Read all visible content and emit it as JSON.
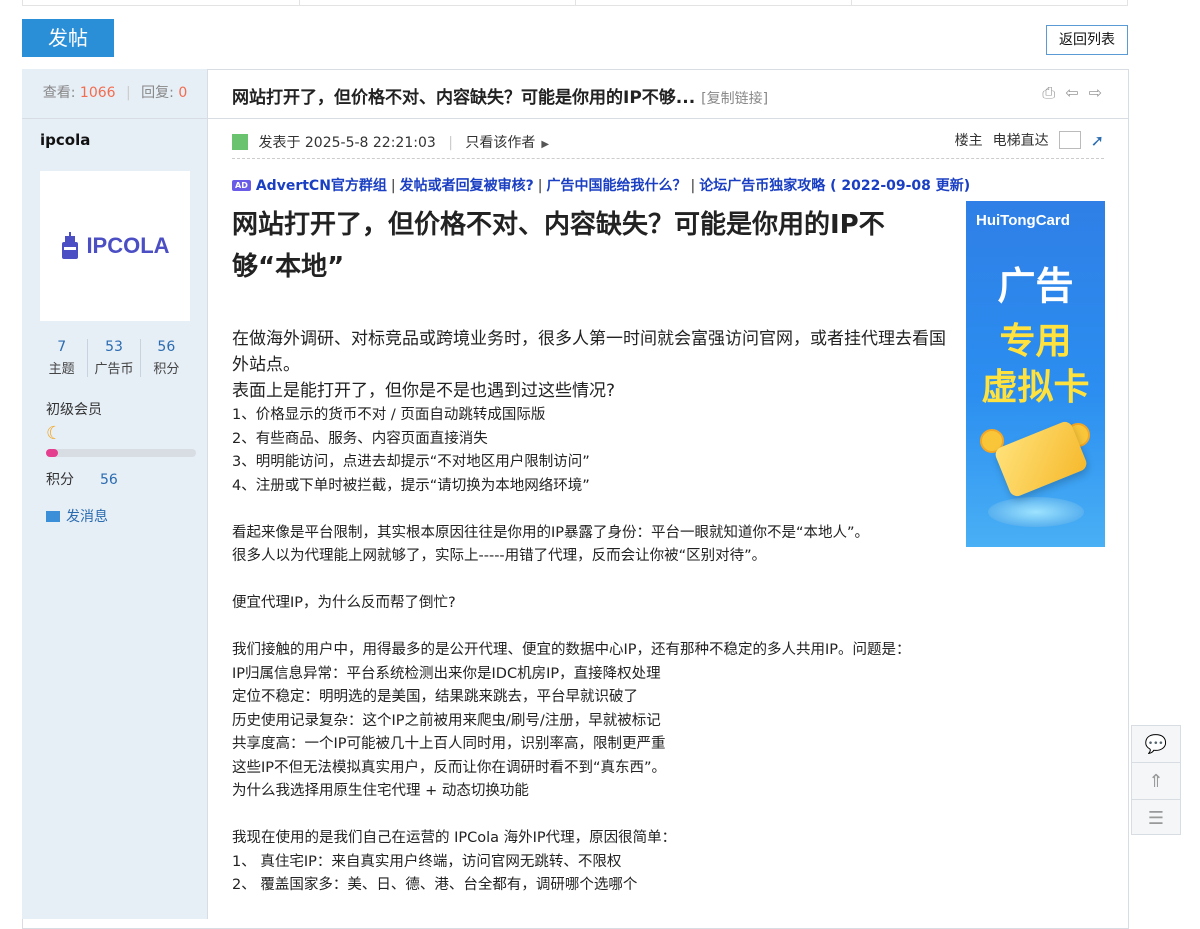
{
  "toolbar": {
    "post_label": "发帖",
    "back_label": "返回列表"
  },
  "stats": {
    "views_label": "查看:",
    "views": "1066",
    "replies_label": "回复:",
    "replies": "0"
  },
  "thread": {
    "title": "网站打开了，但价格不对、内容缺失？可能是你用的IP不够...",
    "copy_link": "[复制链接]"
  },
  "author": {
    "name": "ipcola",
    "avatar_text": "IPCOLA",
    "stats": [
      {
        "value": "7",
        "label": "主题"
      },
      {
        "value": "53",
        "label": "广告币"
      },
      {
        "value": "56",
        "label": "积分"
      }
    ],
    "level": "初级会员",
    "level_progress": 0.08,
    "points_label": "积分",
    "points": "56",
    "send_message": "发消息"
  },
  "post_meta": {
    "posted_at": "发表于 2025-5-8 22:21:03",
    "only_author": "只看该作者",
    "floor": "楼主",
    "elevator": "电梯直达"
  },
  "links": [
    "AdvertCN官方群组",
    "发帖或者回复被审核?",
    "广告中国能给我什么？",
    "论坛广告币独家攻略 ( 2022-09-08 更新)"
  ],
  "ad": {
    "brand": "HuiTongCard",
    "line1": "广告",
    "line2": "专用",
    "line3": "虚拟卡"
  },
  "post": {
    "headline": "网站打开了，但价格不对、内容缺失？可能是你用的IP不够“本地”",
    "intro1": "在做海外调研、对标竞品或跨境业务时，很多人第一时间就会富强访问官网，或者挂代理去看国外站点。",
    "intro2": "表面上是能打开了，但你是不是也遇到过这些情况?",
    "items1": [
      "1、价格显示的货币不对 / 页面自动跳转成国际版",
      "2、有些商品、服务、内容页面直接消失",
      "3、明明能访问，点进去却提示“不对地区用户限制访问”",
      "4、注册或下单时被拦截，提示“请切换为本地网络环境”"
    ],
    "para2": [
      "看起来像是平台限制，其实根本原因往往是你用的IP暴露了身份：平台一眼就知道你不是“本地人”。",
      "很多人以为代理能上网就够了，实际上-----用错了代理，反而会让你被“区别对待”。"
    ],
    "heading2": "便宜代理IP，为什么反而帮了倒忙?",
    "para3": [
      "我们接触的用户中，用得最多的是公开代理、便宜的数据中心IP，还有那种不稳定的多人共用IP。问题是：",
      "IP归属信息异常：平台系统检测出来你是IDC机房IP，直接降权处理",
      "定位不稳定：明明选的是美国，结果跳来跳去，平台早就识破了",
      "历史使用记录复杂：这个IP之前被用来爬虫/刷号/注册，早就被标记",
      "共享度高：一个IP可能被几十上百人同时用，识别率高，限制更严重",
      "这些IP不但无法模拟真实用户，反而让你在调研时看不到“真东西”。",
      "为什么我选择用原生住宅代理 + 动态切换功能"
    ],
    "para4": [
      "我现在使用的是我们自己在运营的 IPCola 海外IP代理，原因很简单：",
      "1、 真住宅IP：来自真实用户终端，访问官网无跳转、不限权",
      "2、 覆盖国家多：美、日、德、港、台全都有，调研哪个选哪个"
    ]
  }
}
